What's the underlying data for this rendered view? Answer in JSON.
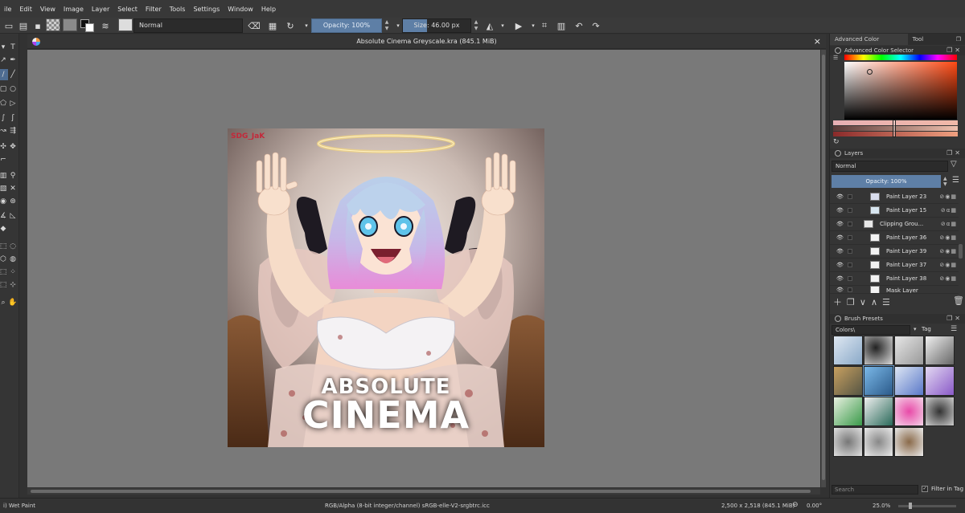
{
  "menubar": {
    "items": [
      "ile",
      "Edit",
      "View",
      "Image",
      "Layer",
      "Select",
      "Filter",
      "Tools",
      "Settings",
      "Window",
      "Help"
    ]
  },
  "toolbar": {
    "blend_mode": "Normal",
    "opacity": "Opacity: 100%",
    "size": "Size: 46.00 px"
  },
  "document": {
    "title": "Absolute Cinema Greyscale.kra (845.1 MiB)",
    "close_glyph": "×"
  },
  "artwork": {
    "line1": "ABSOLUTE",
    "line2": "CINEMA",
    "signature": "SDG_JaK"
  },
  "dock": {
    "tabs": [
      "Advanced Color Selector",
      "Tool Options"
    ],
    "color_panel_title": "Advanced Color Selector",
    "layers_title": "Layers",
    "layers_blend": "Normal",
    "layers_opacity": "Opacity:  100%",
    "layers": [
      {
        "name": "Paint Layer 23"
      },
      {
        "name": "Paint Layer 15"
      },
      {
        "name": "Clipping Grou..."
      },
      {
        "name": "Paint Layer 36"
      },
      {
        "name": "Paint Layer 39"
      },
      {
        "name": "Paint Layer 37"
      },
      {
        "name": "Paint Layer 38"
      },
      {
        "name": "Mask Layer"
      }
    ],
    "brush_title": "Brush Presets",
    "brush_tag_filter": "Colors\\",
    "brush_tag_label": "Tag",
    "search_placeholder": "Search",
    "filter_in_tag": "Filter in Tag"
  },
  "status": {
    "brush": "i) Wet Paint",
    "colorspace": "RGB/Alpha (8-bit integer/channel)  sRGB-elle-V2-srgbtrc.icc",
    "dimensions": "2,500 x 2,518 (845.1 MiB)",
    "rotation": "0.00°",
    "zoom": "25.0%"
  },
  "colors": {
    "accent": "#5e7fa6",
    "canvas_bg": "#797979",
    "panel_bg": "#353535"
  }
}
